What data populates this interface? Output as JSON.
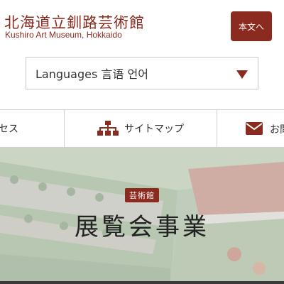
{
  "header": {
    "title": "北海道立釧路芸術館",
    "subtitle": "Kushiro Art Museum, Hokkaido",
    "skip_button": "本文へ"
  },
  "language": {
    "selected": "Languages 言语 언어"
  },
  "nav": {
    "items": [
      {
        "label": "セス",
        "icon": ""
      },
      {
        "label": "サイトマップ",
        "icon": "sitemap-icon"
      },
      {
        "label": "お問",
        "icon": "mail-icon"
      }
    ]
  },
  "hero": {
    "badge": "芸術館",
    "title": "展覧会事業"
  },
  "colors": {
    "brand": "#8b2a1f",
    "border": "#d0d0d0"
  }
}
